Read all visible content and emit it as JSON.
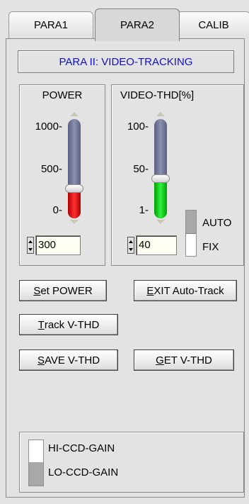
{
  "tabs": [
    {
      "label": "PARA1",
      "active": false
    },
    {
      "label": "PARA2",
      "active": true
    },
    {
      "label": "CALIB",
      "active": false
    }
  ],
  "title": "PARA II: VIDEO-TRACKING",
  "power": {
    "label": "POWER",
    "ticks": [
      "1000-",
      "500-",
      "0-"
    ],
    "value": "300",
    "max": 1000,
    "fill_color": "#ff2020"
  },
  "video_thd": {
    "label": "VIDEO-THD[%]",
    "ticks": [
      "100-",
      "50-",
      "1-"
    ],
    "value": "40",
    "max": 100,
    "fill_color": "#20e030"
  },
  "mode_switch": {
    "upper_label": "AUTO",
    "lower_label": "FIX",
    "selected": "AUTO"
  },
  "buttons": {
    "set_power": {
      "hotkey": "S",
      "rest": "et POWER"
    },
    "exit_auto_track": {
      "hotkey": "E",
      "rest": "XIT Auto-Track"
    },
    "track_vthd": {
      "hotkey": "T",
      "rest": "rack V-THD"
    },
    "save_vthd": {
      "hotkey": "S",
      "rest": "AVE V-THD"
    },
    "get_vthd": {
      "hotkey": "G",
      "rest": "ET V-THD"
    }
  },
  "gain": {
    "upper_label": "HI-CCD-GAIN",
    "lower_label": "LO-CCD-GAIN",
    "selected": "LO-CCD-GAIN"
  },
  "colors": {
    "title_text": "#1010c8",
    "track": "#7a80a0",
    "background": "#e3e3e3"
  }
}
